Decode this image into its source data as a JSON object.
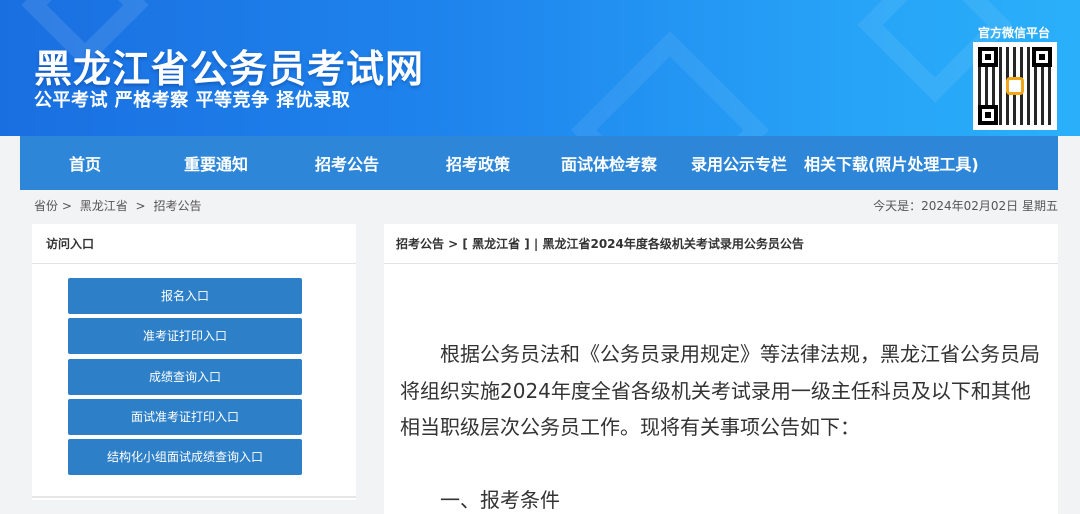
{
  "header": {
    "site_title": "黑龙江省公务员考试网",
    "slogan": "公平考试 严格考察 平等竞争 择优录取",
    "wechat_label": "官方微信平台",
    "brand_color": "#1f86ee"
  },
  "nav": {
    "items": [
      "首页",
      "重要通知",
      "招考公告",
      "招考政策",
      "面试体检考察",
      "录用公示专栏",
      "相关下载(照片处理工具)"
    ]
  },
  "breadcrumb": {
    "items": [
      "省份 >",
      "黑龙江省",
      ">",
      "招考公告"
    ]
  },
  "date": {
    "today": "今天是：2024年02月02日 星期五"
  },
  "sidebar": {
    "title": "访问入口",
    "buttons": [
      "报名入口",
      "准考证打印入口",
      "成绩查询入口",
      "面试准考证打印入口",
      "结构化小组面试成绩查询入口"
    ]
  },
  "article": {
    "path": "招考公告 > [ 黑龙江省 ] | 黑龙江省2024年度各级机关考试录用公务员公告",
    "paragraph": "根据公务员法和《公务员录用规定》等法律法规，黑龙江省公务员局将组织实施2024年度全省各级机关考试录用一级主任科员及以下和其他相当职级层次公务员工作。现将有关事项公告如下：",
    "section_heading": "一、报考条件"
  }
}
